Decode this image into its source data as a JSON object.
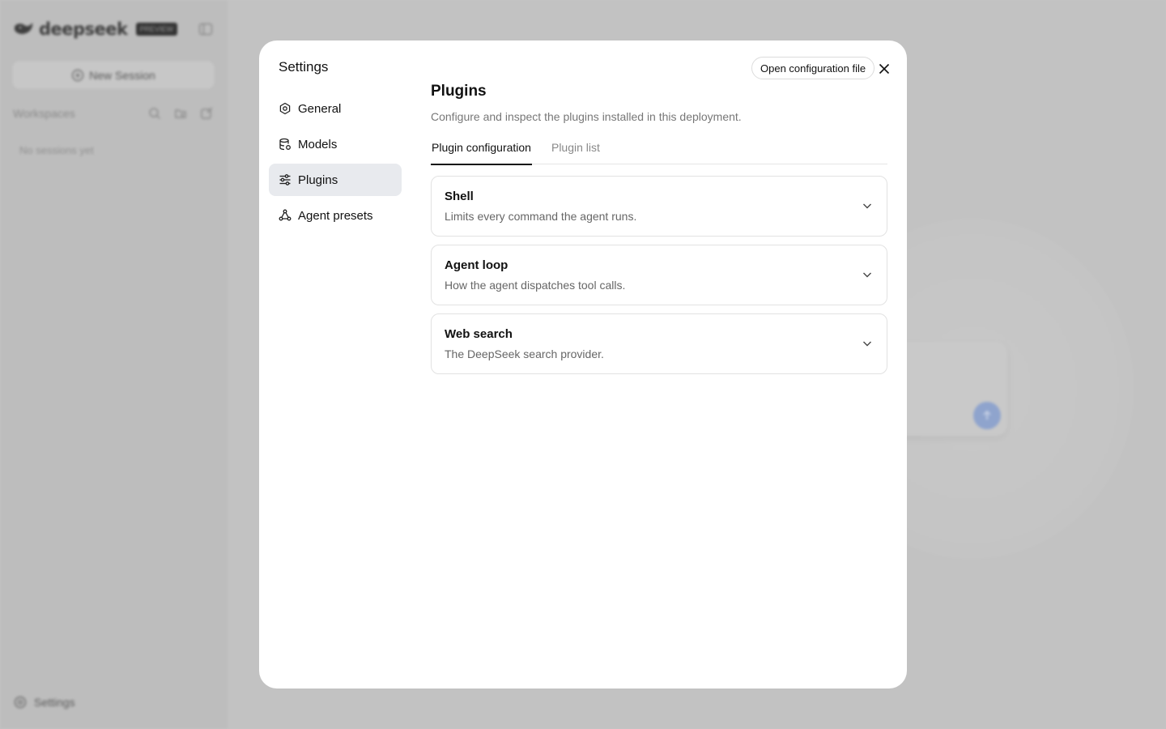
{
  "background": {
    "brand": "deepseek",
    "brand_badge": "PREVIEW",
    "new_session_label": "New Session",
    "workspaces_label": "Workspaces",
    "no_sessions": "No sessions yet",
    "settings_label": "Settings"
  },
  "modal": {
    "title": "Settings",
    "open_config_label": "Open configuration file",
    "nav": [
      {
        "label": "General",
        "icon": "gear-icon",
        "active": false
      },
      {
        "label": "Models",
        "icon": "database-icon",
        "active": false
      },
      {
        "label": "Plugins",
        "icon": "sliders-icon",
        "active": true
      },
      {
        "label": "Agent presets",
        "icon": "nodes-icon",
        "active": false
      }
    ],
    "page": {
      "title": "Plugins",
      "description": "Configure and inspect the plugins installed in this deployment.",
      "tabs": [
        {
          "label": "Plugin configuration",
          "active": true
        },
        {
          "label": "Plugin list",
          "active": false
        }
      ],
      "plugins": [
        {
          "name": "Shell",
          "description": "Limits every command the agent runs."
        },
        {
          "name": "Agent loop",
          "description": "How the agent dispatches tool calls."
        },
        {
          "name": "Web search",
          "description": "The DeepSeek search provider."
        }
      ]
    }
  },
  "colors": {
    "overlay": "#c4c4c4",
    "active_nav": "#e8eaee",
    "send_button": "#8fa4cd"
  }
}
